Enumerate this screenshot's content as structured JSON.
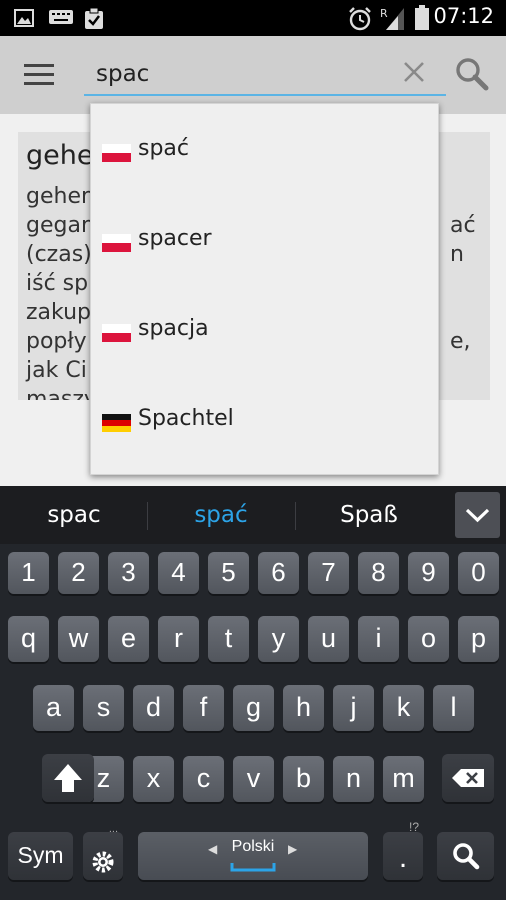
{
  "status_bar": {
    "time": "07:12",
    "icons": [
      "image-icon",
      "keyboard-icon",
      "clipboard-check-icon",
      "alarm-icon",
      "signal-roaming-icon",
      "battery-icon"
    ]
  },
  "app_bar": {
    "search_value": "spac",
    "icons": [
      "menu-icon",
      "clear-icon",
      "search-icon"
    ]
  },
  "entry_card": {
    "title": "gehe",
    "lines": [
      {
        "left": "gehen",
        "right": ""
      },
      {
        "left": "gegan",
        "right": "ać"
      },
      {
        "left": "(czas)",
        "right": "n"
      },
      {
        "left": "iść sp",
        "right": ""
      },
      {
        "left": "zakup",
        "right": ""
      },
      {
        "left": "popły",
        "right": "e,"
      },
      {
        "left": "jak Ci",
        "right": ""
      },
      {
        "left": "maszy",
        "right": ""
      }
    ]
  },
  "suggestions": [
    {
      "label": "spać",
      "flag": "pl"
    },
    {
      "label": "spacer",
      "flag": "pl"
    },
    {
      "label": "spacja",
      "flag": "pl"
    },
    {
      "label": "Spachtel",
      "flag": "de"
    }
  ],
  "keyboard": {
    "predictions": [
      "spac",
      "spać",
      "Spaß"
    ],
    "active_prediction_index": 1,
    "number_row": [
      "1",
      "2",
      "3",
      "4",
      "5",
      "6",
      "7",
      "8",
      "9",
      "0"
    ],
    "row1": [
      "q",
      "w",
      "e",
      "r",
      "t",
      "y",
      "u",
      "i",
      "o",
      "p"
    ],
    "row2": [
      "a",
      "s",
      "d",
      "f",
      "g",
      "h",
      "j",
      "k",
      "l"
    ],
    "row3": [
      "z",
      "x",
      "c",
      "v",
      "b",
      "n",
      "m"
    ],
    "sym_label": "Sym",
    "space_label": "Polski",
    "period_label": ".",
    "period_hint": "!?",
    "settings_hint": "..."
  },
  "colors": {
    "accent": "#2ca4e8",
    "app_bar": "#cfcfcf",
    "keyboard_bg": "#23262b",
    "key": "#5e626a",
    "polish_flag_red": "#dc143c",
    "german_flag_gold": "#ffce00"
  }
}
